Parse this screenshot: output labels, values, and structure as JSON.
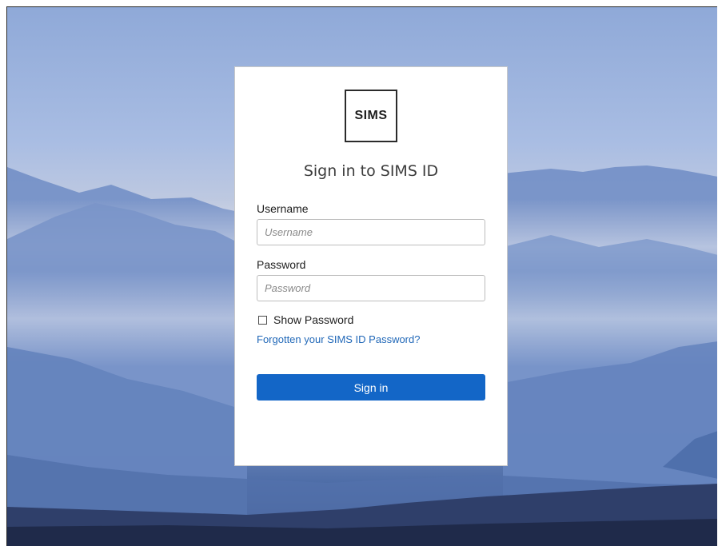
{
  "logo": {
    "text": "SIMS"
  },
  "page": {
    "title": "Sign in to SIMS ID"
  },
  "username": {
    "label": "Username",
    "placeholder": "Username",
    "value": ""
  },
  "password": {
    "label": "Password",
    "placeholder": "Password",
    "value": ""
  },
  "show_password": {
    "label": "Show Password",
    "checked": false
  },
  "forgot_link": {
    "text": "Forgotten your SIMS ID Password?"
  },
  "signin_button": {
    "label": "Sign in"
  },
  "colors": {
    "primary_button": "#1366c7",
    "link": "#2168b8",
    "sky_top": "#8fa9d8",
    "mountain_dark": "#28365c"
  }
}
